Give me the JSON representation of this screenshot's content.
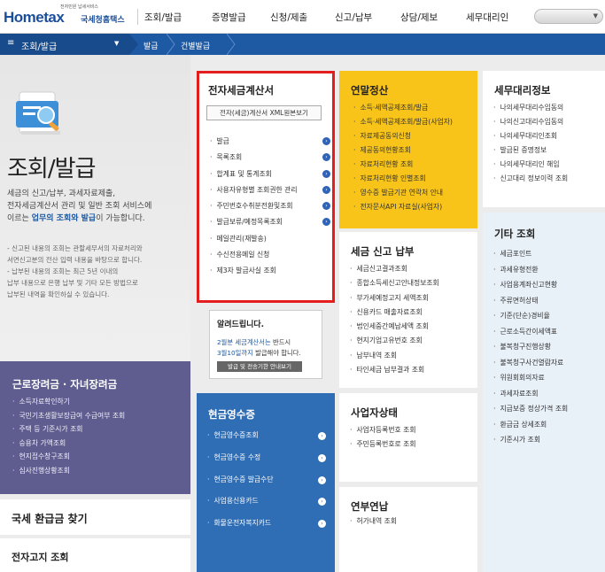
{
  "header": {
    "logo_small": "전자민원 납세서비스",
    "logo_word": "Hometax",
    "logo_korean": "국세청홈택스",
    "menu": [
      "조회/발급",
      "증명발급",
      "신청/제출",
      "신고/납부",
      "상담/제보",
      "세무대리인"
    ]
  },
  "breadcrumb": {
    "main": "조회/발급",
    "items": [
      "발급",
      "건별발급"
    ]
  },
  "hero": {
    "title": "조회/발급",
    "desc_1": "세금의 신고/납부, 과세자료제출,",
    "desc_2": "전자세금계산서 관리 및 일반 조회 서비스에",
    "desc_3a": "이르는 ",
    "desc_3b": "업무의 조회와 발급",
    "desc_3c": "이 가능합니다.",
    "note_1": "- 신고된 내용의 조회는 관할세무서의 자료처리와",
    "note_2": "  서면신고분의 전산 입력 내용을 바탕으로 합니다.",
    "note_3": "- 납부된 내용의 조회는 최근 5년 이내의",
    "note_4": "  납부 내용으로 은행 납부 및 기타 모든 방법으로",
    "note_5": "  납부된 내역을 확인하실 수 있습니다."
  },
  "etax": {
    "title": "전자세금계산서",
    "button": "전자(세금)계산서 XML원본보기",
    "items": [
      "발급",
      "목록조회",
      "합계표 및 통계조회",
      "사용자유형별 조회권한 관리",
      "주민번호수취분전환및조회",
      "발급보류/예정목록조회",
      "메일관리(재발송)",
      "수신전용메일 신청",
      "제3자 발급사실 조회"
    ]
  },
  "notice": {
    "title": "알려드립니다.",
    "line_1a": "2월분 세금계산서는",
    "line_1b": " 반드시",
    "line_2a": "3월10일까지",
    "line_2b": " 발급해야 합니다.",
    "button": "발급 및 전송기한 안내보기"
  },
  "year_end": {
    "title": "연말정산",
    "items": [
      "소득·세액공제조회/발급",
      "소득·세액공제조회/발급(사업자)",
      "자료제공동의신청",
      "제공동의현황조회",
      "자료처리현황 조회",
      "자료처리현황 인별조회",
      "영수증 발급기관 연락처 안내",
      "전자문서API 자료실(사업자)"
    ]
  },
  "report": {
    "title": "세금 신고 납부",
    "items": [
      "세금신고결과조회",
      "종합소득세신고안내정보조회",
      "부가세예정고지 세액조회",
      "신용카드 매출자료조회",
      "법인세중간예납세액 조회",
      "현지기업고유번호 조회",
      "납부내역 조회",
      "타인세금 납부결과 조회"
    ]
  },
  "agent": {
    "title": "세무대리정보",
    "items": [
      "나의세무대리수임동의",
      "나의신고대리수임동의",
      "나의세무대리인조회",
      "발급된 증명정보",
      "나의세무대리인 해임",
      "신고대리 정보이력 조회"
    ]
  },
  "etc": {
    "title": "기타 조회",
    "items": [
      "세금포인트",
      "과세유형전환",
      "사업용계좌신고현황",
      "주류면허상태",
      "기준(단순)경비율",
      "근로소득간이세액표",
      "불복청구진행상황",
      "불복청구사건열람자료",
      "위원회회의자료",
      "과세자료조회",
      "지급보증 정상가격 조회",
      "환급금 상세조회",
      "기준시가 조회"
    ]
  },
  "labor": {
    "title": "근로장려금 · 자녀장려금",
    "items": [
      "소득자료확인하기",
      "국민기초생활보장급여 수급여부 조회",
      "주택 등 기준시가 조회",
      "승용차 가액조회",
      "현지접수창구조회",
      "심사진행상황조회"
    ]
  },
  "cash": {
    "title": "현금영수증",
    "items": [
      "현금영수증조회",
      "현금영수증 수정",
      "현금영수증 발급수단",
      "사업용신용카드",
      "화물운전자복지카드"
    ]
  },
  "biz": {
    "title": "사업자상태",
    "items": [
      "사업자등록번호 조회",
      "주민등록번호로 조회"
    ]
  },
  "bizyear": {
    "title": "연부연납",
    "items": [
      "허가내역 조회"
    ]
  },
  "refund": {
    "title": "국세 환급금 찾기"
  },
  "bill": {
    "title": "전자고지 조회"
  }
}
